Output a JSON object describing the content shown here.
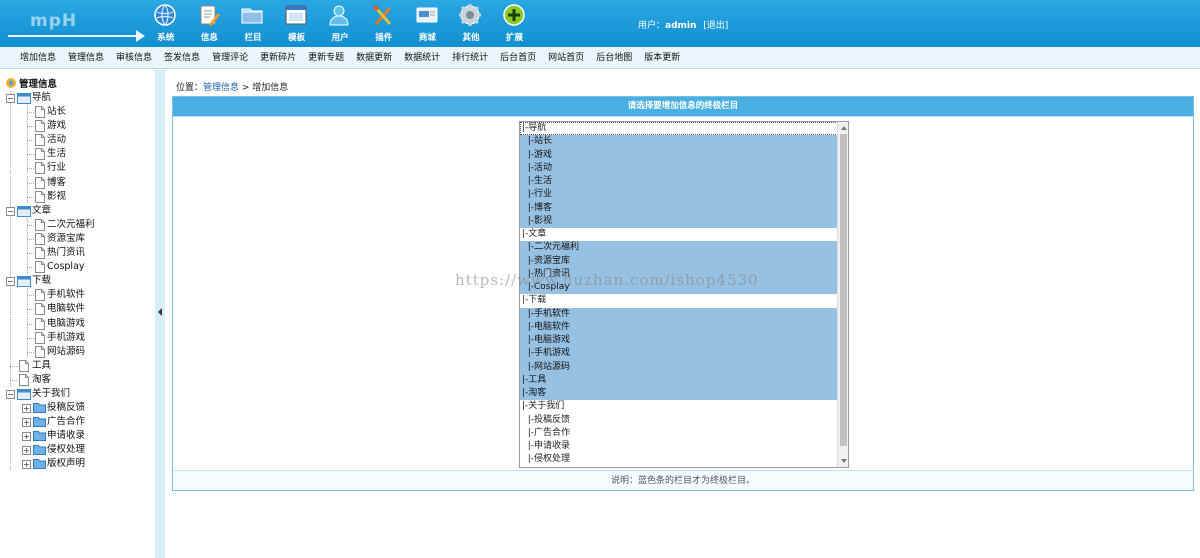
{
  "header": {
    "logo_text": "mpH",
    "nav": [
      {
        "label": "系统",
        "icon": "globe-icon"
      },
      {
        "label": "信息",
        "icon": "document-pencil-icon"
      },
      {
        "label": "栏目",
        "icon": "folder-icon"
      },
      {
        "label": "模板",
        "icon": "window-icon"
      },
      {
        "label": "用户",
        "icon": "user-icon"
      },
      {
        "label": "插件",
        "icon": "tools-icon"
      },
      {
        "label": "商城",
        "icon": "card-icon"
      },
      {
        "label": "其他",
        "icon": "gear-icon"
      },
      {
        "label": "扩展",
        "icon": "plus-circle-icon"
      }
    ],
    "user_label": "用户：",
    "username": "admin",
    "logout_label": "[退出]"
  },
  "menubar": [
    "增加信息",
    "管理信息",
    "审核信息",
    "签发信息",
    "管理评论",
    "更新碎片",
    "更新专题",
    "数据更新",
    "数据统计",
    "排行统计",
    "后台首页",
    "网站首页",
    "后台地图",
    "版本更新"
  ],
  "sidebar": {
    "root_label": "管理信息",
    "groups": [
      {
        "label": "导航",
        "children": [
          "站长",
          "游戏",
          "活动",
          "生活",
          "行业",
          "博客",
          "影视"
        ]
      },
      {
        "label": "文章",
        "children": [
          "二次元福利",
          "资源宝库",
          "热门资讯",
          "Cosplay"
        ]
      },
      {
        "label": "下载",
        "children": [
          "手机软件",
          "电脑软件",
          "电脑游戏",
          "手机游戏",
          "网站源码"
        ]
      }
    ],
    "leaves": [
      "工具",
      "淘客"
    ],
    "about": {
      "label": "关于我们",
      "children": [
        "投稿反馈",
        "广告合作",
        "申请收录",
        "侵权处理",
        "版权声明"
      ]
    }
  },
  "breadcrumb": {
    "prefix": "位置：",
    "link": "管理信息",
    "sep": " > ",
    "current": "增加信息"
  },
  "panel": {
    "title": "请选择要增加信息的终极栏目",
    "footer": "说明：蓝色条的栏目才为终极栏目。",
    "options": [
      {
        "text": "|-导航",
        "selected": false
      },
      {
        "text": "  |-站长",
        "selected": true
      },
      {
        "text": "  |-游戏",
        "selected": true
      },
      {
        "text": "  |-活动",
        "selected": true
      },
      {
        "text": "  |-生活",
        "selected": true
      },
      {
        "text": "  |-行业",
        "selected": true
      },
      {
        "text": "  |-博客",
        "selected": true
      },
      {
        "text": "  |-影视",
        "selected": true
      },
      {
        "text": "|-文章",
        "selected": false
      },
      {
        "text": "  |-二次元福利",
        "selected": true
      },
      {
        "text": "  |-资源宝库",
        "selected": true
      },
      {
        "text": "  |-热门资讯",
        "selected": true
      },
      {
        "text": "  |-Cosplay",
        "selected": true
      },
      {
        "text": "|-下载",
        "selected": false
      },
      {
        "text": "  |-手机软件",
        "selected": true
      },
      {
        "text": "  |-电脑软件",
        "selected": true
      },
      {
        "text": "  |-电脑游戏",
        "selected": true
      },
      {
        "text": "  |-手机游戏",
        "selected": true
      },
      {
        "text": "  |-网站源码",
        "selected": true
      },
      {
        "text": "|-工具",
        "selected": true
      },
      {
        "text": "|-淘客",
        "selected": true
      },
      {
        "text": "|-关于我们",
        "selected": false
      },
      {
        "text": "  |-投稿反馈",
        "selected": false
      },
      {
        "text": "  |-广告合作",
        "selected": false
      },
      {
        "text": "  |-申请收录",
        "selected": false
      },
      {
        "text": "  |-侵权处理",
        "selected": false
      }
    ]
  },
  "watermark": "https://www.huzhan.com/ishop4530",
  "colors": {
    "header": "#1a9bd9",
    "selected_option": "#97c1e3",
    "panel_head": "#48afe0"
  }
}
